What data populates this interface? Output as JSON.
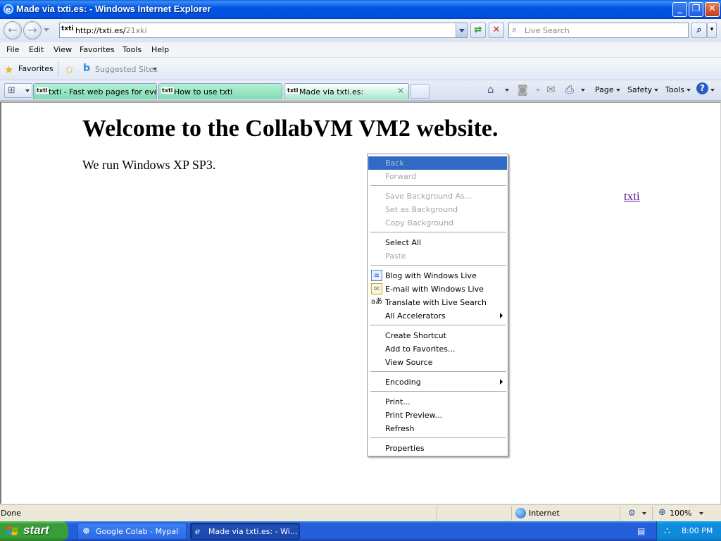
{
  "window": {
    "title": "Made via txti.es: - Windows Internet Explorer",
    "minimize_label": "_",
    "maximize_label": "❐",
    "close_label": "✕"
  },
  "address_bar": {
    "site_icon": "txti",
    "url_host": "http://txti.es/",
    "url_path": "21xki",
    "search_placeholder": "Live Search"
  },
  "menu": {
    "items": [
      "File",
      "Edit",
      "View",
      "Favorites",
      "Tools",
      "Help"
    ]
  },
  "favorites_bar": {
    "favorites_label": "Favorites",
    "suggested_sites_label": "Suggested Sites"
  },
  "tabs": [
    {
      "icon": "txti",
      "label": "txti - Fast web pages for eve..."
    },
    {
      "icon": "txti",
      "label": "How to use txti"
    },
    {
      "icon": "txti",
      "label": "Made via txti.es:",
      "active": true
    }
  ],
  "command_bar": {
    "page_label": "Page",
    "safety_label": "Safety",
    "tools_label": "Tools"
  },
  "page": {
    "heading": "Welcome to the CollabVM VM2 website.",
    "paragraph": "We run Windows XP SP3.",
    "link": "txti"
  },
  "context_menu": {
    "back": "Back",
    "forward": "Forward",
    "save_background": "Save Background As...",
    "set_background": "Set as Background",
    "copy_background": "Copy Background",
    "select_all": "Select All",
    "paste": "Paste",
    "blog": "Blog with Windows Live",
    "email": "E-mail with Windows Live",
    "translate": "Translate with Live Search",
    "accelerators": "All Accelerators",
    "create_shortcut": "Create Shortcut",
    "add_favorites": "Add to Favorites...",
    "view_source": "View Source",
    "encoding": "Encoding",
    "print": "Print...",
    "print_preview": "Print Preview...",
    "refresh": "Refresh",
    "properties": "Properties"
  },
  "status_bar": {
    "status": "Done",
    "zone": "Internet",
    "zoom": "100%"
  },
  "taskbar": {
    "start_label": "start",
    "tasks": [
      "Google Colab - Mypal",
      "Made via txti.es: - Wi..."
    ],
    "clock": "8:00 PM"
  },
  "colors": {
    "titlebar": "#0054e3",
    "tab_green": "#7fdcb0",
    "highlight": "#316ac5",
    "start_green": "#37a037",
    "visited_link": "#551a8b"
  }
}
